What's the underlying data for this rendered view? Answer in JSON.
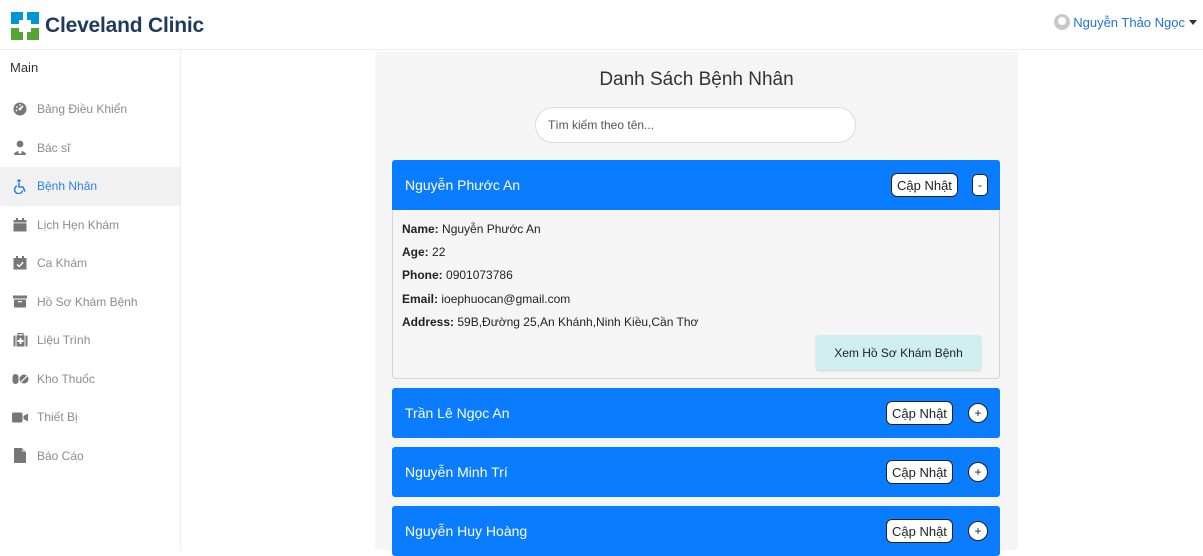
{
  "brand": {
    "name": "Cleveland Clinic"
  },
  "user": {
    "name": "Nguyễn Thảo Ngọc"
  },
  "sidebar": {
    "heading": "Main",
    "items": [
      {
        "label": "Bảng Điều Khiển",
        "icon": "dashboard-icon"
      },
      {
        "label": "Bác sĩ",
        "icon": "doctor-icon"
      },
      {
        "label": "Bệnh Nhân",
        "icon": "wheelchair-icon",
        "active": true
      },
      {
        "label": "Lịch Hẹn Khám",
        "icon": "calendar-icon"
      },
      {
        "label": "Ca Khám",
        "icon": "calendar-check-icon"
      },
      {
        "label": "Hồ Sơ Khám Bệnh",
        "icon": "archive-icon"
      },
      {
        "label": "Liệu Trình",
        "icon": "medkit-icon"
      },
      {
        "label": "Kho Thuốc",
        "icon": "pills-icon"
      },
      {
        "label": "Thiết Bị",
        "icon": "video-camera-icon"
      },
      {
        "label": "Báo Cáo",
        "icon": "file-icon"
      }
    ]
  },
  "main": {
    "title": "Danh Sách Bệnh Nhân",
    "search_placeholder": "Tìm kiếm theo tên...",
    "update_label": "Cập Nhật",
    "expanded_toggle": "-",
    "collapsed_toggle": "+",
    "field_labels": {
      "name": "Name:",
      "age": "Age:",
      "phone": "Phone:",
      "email": "Email:",
      "address": "Address:"
    },
    "record_button": "Xem Hồ Sơ Khám Bệnh",
    "patients": [
      {
        "name": "Nguyễn Phước An",
        "expanded": true,
        "age": "22",
        "phone": "0901073786",
        "email": "ioephuocan@gmail.com",
        "address": "59B,Đường 25,An Khánh,Ninh Kiều,Cần Thơ"
      },
      {
        "name": "Trần Lê Ngọc An",
        "expanded": false
      },
      {
        "name": "Nguyễn Minh Trí",
        "expanded": false
      },
      {
        "name": "Nguyễn Huy Hoàng",
        "expanded": false
      }
    ]
  },
  "colors": {
    "header_blue": "#0a7cff",
    "active_link": "#2f80ed",
    "record_button_bg": "#cfeef0"
  }
}
